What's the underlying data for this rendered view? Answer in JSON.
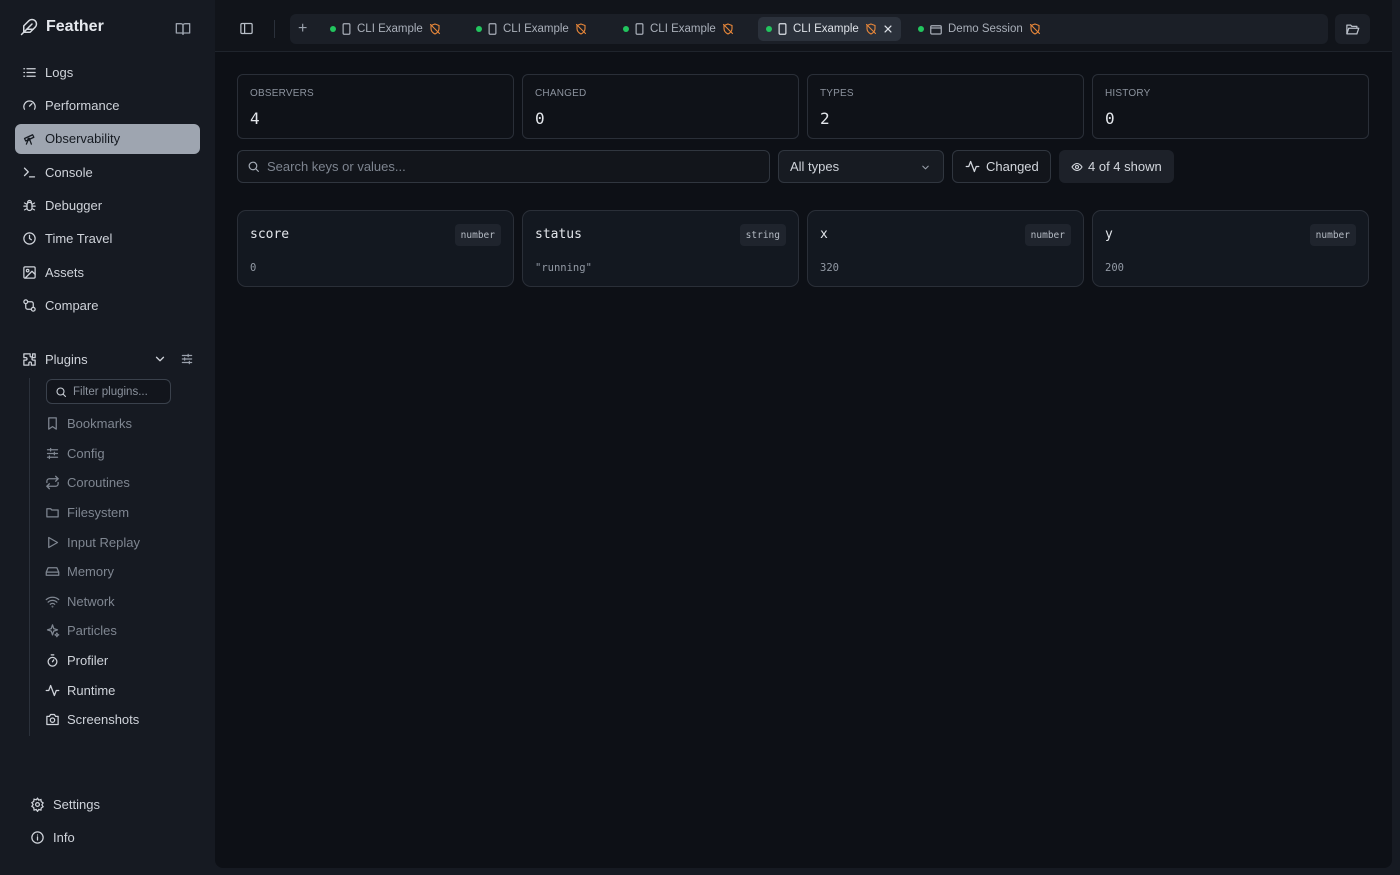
{
  "app": {
    "name": "Feather"
  },
  "sidebar": {
    "nav": [
      {
        "label": "Logs",
        "icon": "list-icon"
      },
      {
        "label": "Performance",
        "icon": "gauge-icon"
      },
      {
        "label": "Observability",
        "icon": "telescope-icon",
        "active": true
      },
      {
        "label": "Console",
        "icon": "terminal-icon"
      },
      {
        "label": "Debugger",
        "icon": "bug-icon"
      },
      {
        "label": "Time Travel",
        "icon": "clock-icon"
      },
      {
        "label": "Assets",
        "icon": "image-icon"
      },
      {
        "label": "Compare",
        "icon": "compare-icon"
      }
    ],
    "plugins": {
      "label": "Plugins",
      "filter_placeholder": "Filter plugins...",
      "items": [
        {
          "label": "Bookmarks",
          "icon": "bookmark-icon",
          "enabled": false
        },
        {
          "label": "Config",
          "icon": "sliders-icon",
          "enabled": false
        },
        {
          "label": "Coroutines",
          "icon": "repeat-icon",
          "enabled": false
        },
        {
          "label": "Filesystem",
          "icon": "folder-icon",
          "enabled": false
        },
        {
          "label": "Input Replay",
          "icon": "play-icon",
          "enabled": false
        },
        {
          "label": "Memory",
          "icon": "drive-icon",
          "enabled": false
        },
        {
          "label": "Network",
          "icon": "wifi-icon",
          "enabled": false
        },
        {
          "label": "Particles",
          "icon": "sparkles-icon",
          "enabled": false
        },
        {
          "label": "Profiler",
          "icon": "stopwatch-icon",
          "enabled": true
        },
        {
          "label": "Runtime",
          "icon": "activity-icon",
          "enabled": true
        },
        {
          "label": "Screenshots",
          "icon": "camera-icon",
          "enabled": true
        }
      ]
    },
    "footer": [
      {
        "label": "Settings",
        "icon": "gear-icon"
      },
      {
        "label": "Info",
        "icon": "info-icon"
      }
    ]
  },
  "tabs": [
    {
      "label": "CLI Example",
      "kind": "device",
      "active": false
    },
    {
      "label": "CLI Example",
      "kind": "device",
      "active": false
    },
    {
      "label": "CLI Example",
      "kind": "device",
      "active": false
    },
    {
      "label": "CLI Example",
      "kind": "device",
      "active": true
    },
    {
      "label": "Demo Session",
      "kind": "session",
      "active": false
    }
  ],
  "stats": [
    {
      "label": "OBSERVERS",
      "value": "4"
    },
    {
      "label": "CHANGED",
      "value": "0"
    },
    {
      "label": "TYPES",
      "value": "2"
    },
    {
      "label": "HISTORY",
      "value": "0"
    }
  ],
  "filters": {
    "search_placeholder": "Search keys or values...",
    "type_select": "All types",
    "changed_label": "Changed",
    "shown_label": "4 of 4 shown"
  },
  "observers": [
    {
      "key": "score",
      "type": "number",
      "value": "0"
    },
    {
      "key": "status",
      "type": "string",
      "value": "\"running\""
    },
    {
      "key": "x",
      "type": "number",
      "value": "320"
    },
    {
      "key": "y",
      "type": "number",
      "value": "200"
    }
  ],
  "colors": {
    "status_dot": "#22c55e",
    "warning_icon": "#e8873a",
    "active_nav_bg": "#9ea5b0"
  }
}
